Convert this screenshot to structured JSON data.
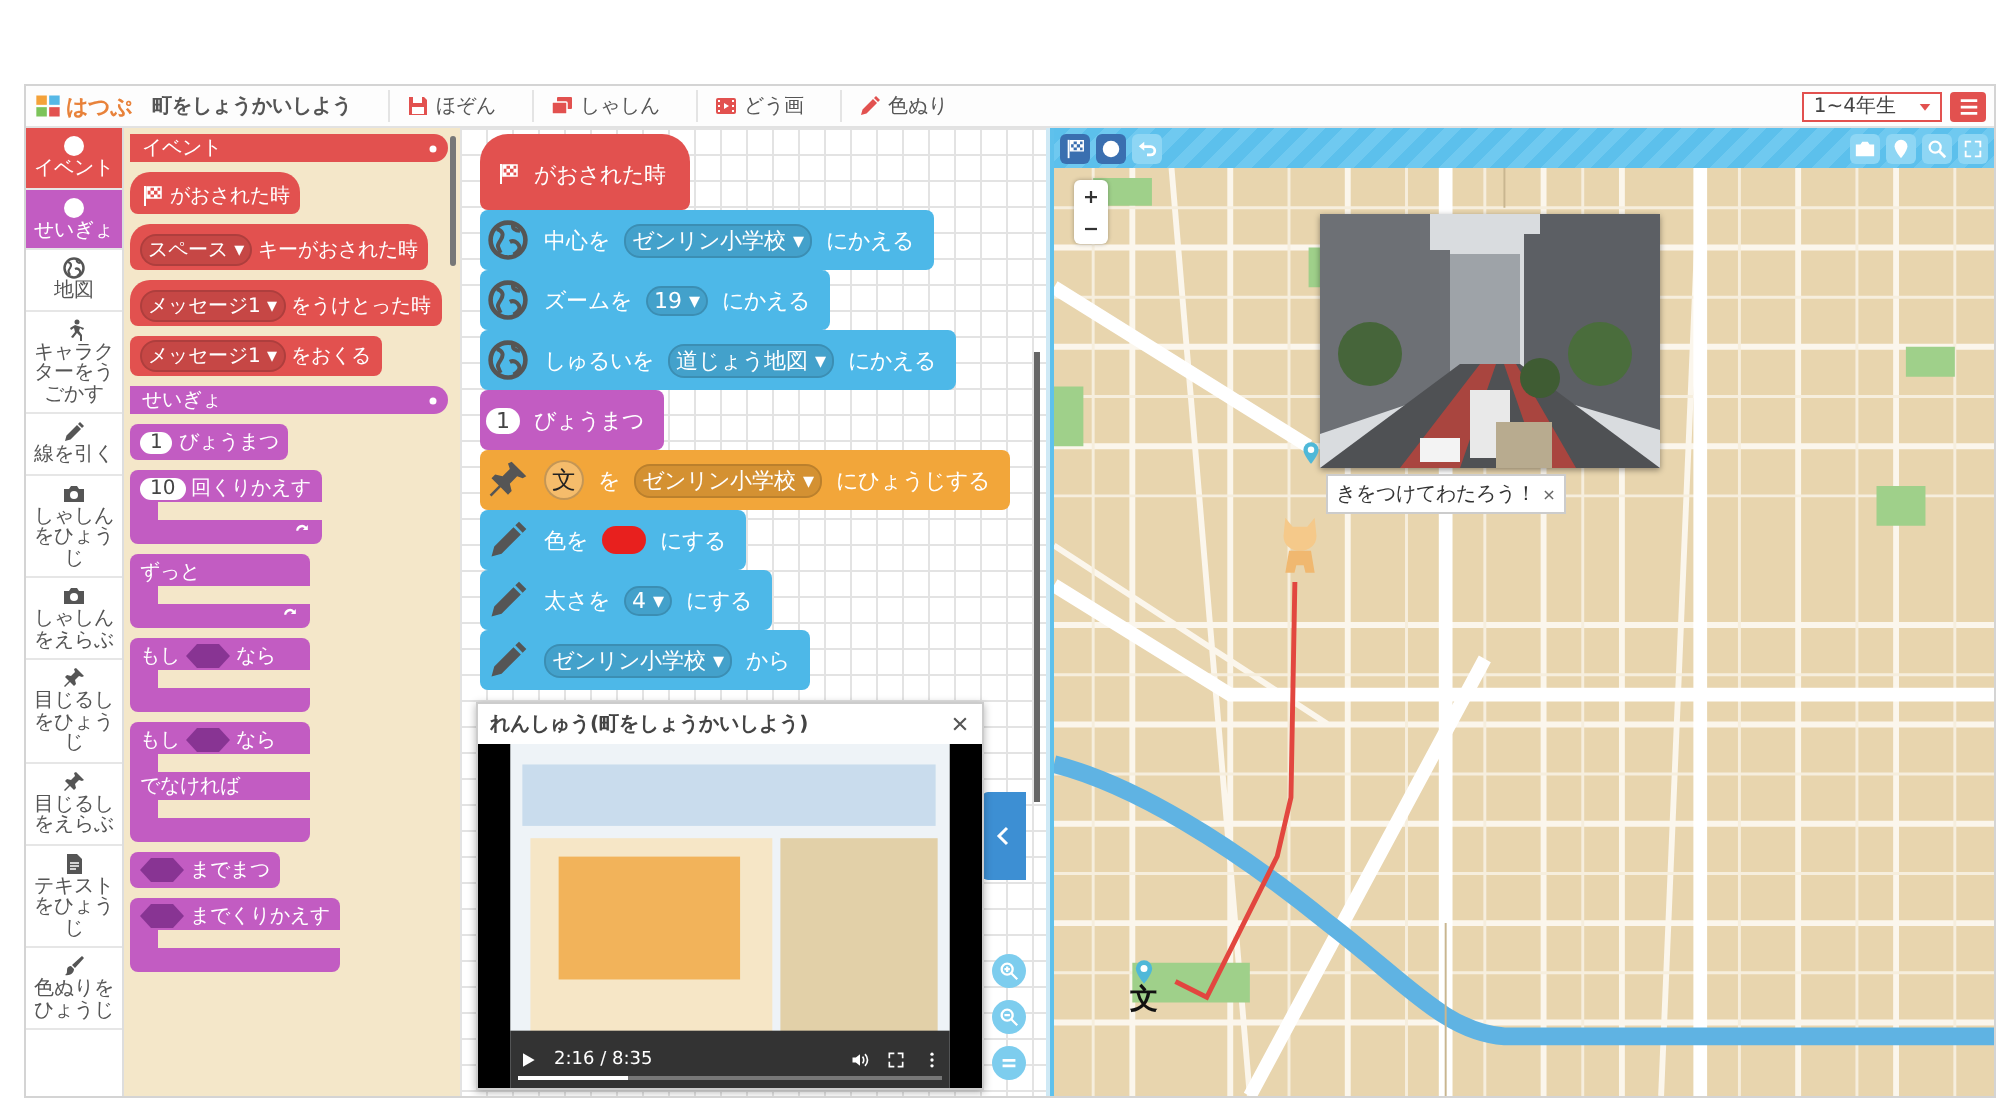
{
  "toolbar": {
    "logo": "はつぷ",
    "title": "町をしょうかいしよう",
    "menu": [
      {
        "label": "ほぞん"
      },
      {
        "label": "しゃしん"
      },
      {
        "label": "どう画"
      },
      {
        "label": "色ぬり"
      }
    ],
    "grade": "1~4年生"
  },
  "categories": [
    {
      "label": "イベント",
      "color": "#e2514f"
    },
    {
      "label": "せいぎょ",
      "color": "#c25cc2"
    },
    {
      "label": "地図"
    },
    {
      "label": "キャラクターをうごかす"
    },
    {
      "label": "線を引く"
    },
    {
      "label": "しゃしんをひょうじ"
    },
    {
      "label": "しゃしんをえらぶ"
    },
    {
      "label": "目じるしをひょうじ"
    },
    {
      "label": "目じるしをえらぶ"
    },
    {
      "label": "テキストをひょうじ"
    },
    {
      "label": "色ぬりをひょうじ"
    }
  ],
  "palette": [
    {
      "title": "イベント",
      "kind": "event",
      "blocks": [
        {
          "kind": "hat",
          "parts": [
            {
              "kind": "flag"
            },
            {
              "kind": "text",
              "text": "がおされた時"
            }
          ]
        },
        {
          "kind": "hat",
          "parts": [
            {
              "kind": "dropdown",
              "text": "スペース ▾"
            },
            {
              "kind": "text",
              "text": "キーがおされた時"
            }
          ]
        },
        {
          "kind": "hat",
          "parts": [
            {
              "kind": "dropdown",
              "text": "メッセージ1 ▾"
            },
            {
              "kind": "text",
              "text": "をうけとった時"
            }
          ]
        },
        {
          "kind": "stack",
          "parts": [
            {
              "kind": "dropdown",
              "text": "メッセージ1 ▾"
            },
            {
              "kind": "text",
              "text": "をおくる"
            }
          ]
        }
      ]
    },
    {
      "title": "せいぎょ",
      "kind": "control",
      "blocks": [
        {
          "kind": "stack",
          "parts": [
            {
              "kind": "number",
              "text": "1"
            },
            {
              "kind": "text",
              "text": "びょうまつ"
            }
          ]
        },
        {
          "kind": "loop",
          "parts": [
            {
              "kind": "number",
              "text": "10"
            },
            {
              "kind": "text",
              "text": "回くりかえす"
            }
          ]
        },
        {
          "kind": "loop",
          "parts": [
            {
              "kind": "text",
              "text": "ずっと"
            }
          ]
        },
        {
          "kind": "c",
          "parts": [
            {
              "kind": "text",
              "text": "もし"
            },
            {
              "kind": "slot"
            },
            {
              "kind": "text",
              "text": "なら"
            }
          ]
        },
        {
          "kind": "ifelse",
          "parts": [
            {
              "kind": "text",
              "text": "もし"
            },
            {
              "kind": "slot"
            },
            {
              "kind": "text",
              "text": "なら"
            }
          ],
          "else": "でなければ"
        },
        {
          "kind": "stack",
          "parts": [
            {
              "kind": "slot"
            },
            {
              "kind": "text",
              "text": "までまつ"
            }
          ]
        },
        {
          "kind": "c",
          "parts": [
            {
              "kind": "slot"
            },
            {
              "kind": "text",
              "text": "までくりかえす"
            }
          ]
        }
      ]
    }
  ],
  "script": [
    {
      "kind": "event",
      "parts": [
        {
          "kind": "flag"
        },
        {
          "kind": "text",
          "text": "がおされた時"
        }
      ]
    },
    {
      "kind": "map",
      "parts": [
        {
          "kind": "text",
          "text": "中心を"
        },
        {
          "kind": "dropdown",
          "text": "ゼンリン小学校 ▾"
        },
        {
          "kind": "text",
          "text": "にかえる"
        }
      ]
    },
    {
      "kind": "map",
      "parts": [
        {
          "kind": "text",
          "text": "ズームを"
        },
        {
          "kind": "dropdown",
          "text": "19 ▾"
        },
        {
          "kind": "text",
          "text": "にかえる"
        }
      ]
    },
    {
      "kind": "map",
      "parts": [
        {
          "kind": "text",
          "text": "しゅるいを"
        },
        {
          "kind": "dropdown",
          "text": "道じょう地図 ▾"
        },
        {
          "kind": "text",
          "text": "にかえる"
        }
      ]
    },
    {
      "kind": "control",
      "parts": [
        {
          "kind": "number",
          "text": "1"
        },
        {
          "kind": "text",
          "text": "びょうまつ"
        }
      ]
    },
    {
      "kind": "marker",
      "parts": [
        {
          "kind": "symbol",
          "text": "文"
        },
        {
          "kind": "text",
          "text": "を"
        },
        {
          "kind": "dropdown",
          "text": "ゼンリン小学校 ▾"
        },
        {
          "kind": "text",
          "text": "にひょうじする"
        }
      ]
    },
    {
      "kind": "pen",
      "parts": [
        {
          "kind": "text",
          "text": "色を"
        },
        {
          "kind": "color",
          "color": "#e8201e"
        },
        {
          "kind": "text",
          "text": "にする"
        }
      ]
    },
    {
      "kind": "pen",
      "parts": [
        {
          "kind": "text",
          "text": "太さを"
        },
        {
          "kind": "dropdown",
          "text": "4 ▾"
        },
        {
          "kind": "text",
          "text": "にする"
        }
      ]
    },
    {
      "kind": "pen",
      "parts": [
        {
          "kind": "dropdown",
          "text": "ゼンリン小学校 ▾"
        },
        {
          "kind": "text",
          "text": "から"
        }
      ]
    }
  ],
  "dialog": {
    "title": "れんしゅう(町をしょうかいしよう)",
    "time": "2:16 / 8:35",
    "level": 0.26
  },
  "map": {
    "bubble": "きをつけてわたろう！",
    "marker_symbol": "文"
  }
}
